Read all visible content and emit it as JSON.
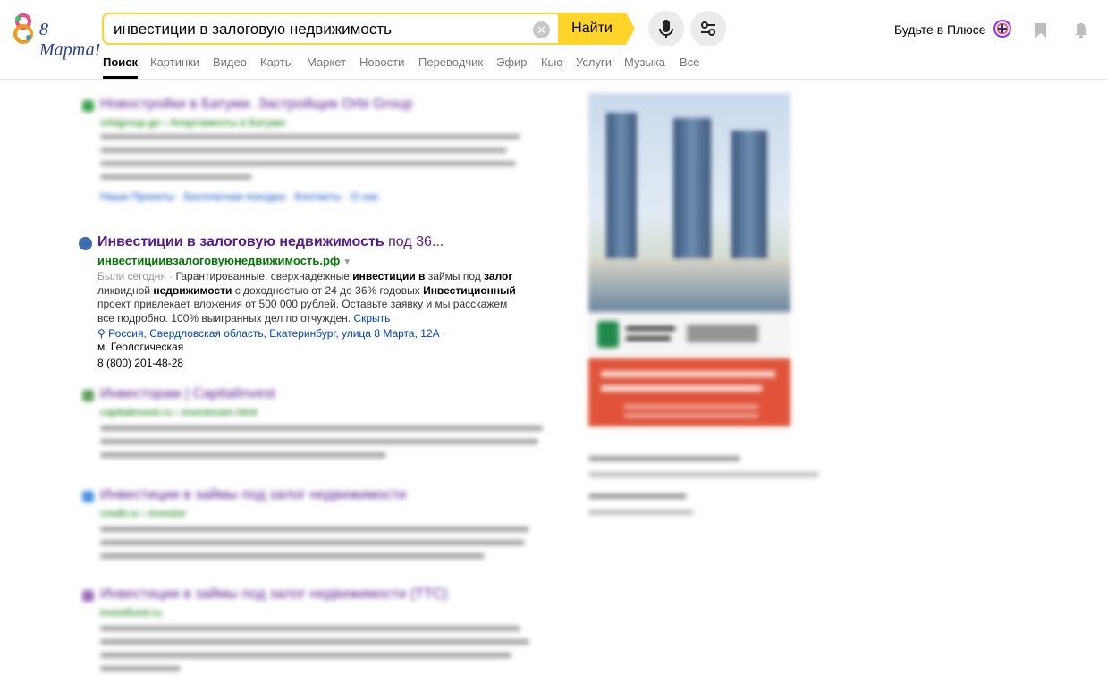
{
  "header": {
    "logo_text": "8 Марта!",
    "search_value": "инвестиции в залоговую недвижимость",
    "find_label": "Найти",
    "plus_label": "Будьте в Плюсе",
    "icons": [
      "clear-icon",
      "microphone-icon",
      "filter-settings-icon",
      "plus-logo-icon",
      "bookmark-icon",
      "bell-icon"
    ]
  },
  "tabs": [
    "Поиск",
    "Картинки",
    "Видео",
    "Карты",
    "Маркет",
    "Новости",
    "Переводчик",
    "Эфир",
    "Кью",
    "Услуги",
    "Музыка",
    "Все"
  ],
  "featured_result": {
    "title_bold": "Инвестиции в залоговую недвижимость",
    "title_rest": " под 36...",
    "url": "инвестициивзалоговуюнедвижимость.рф",
    "visited": "Были сегодня",
    "snippet_parts": [
      {
        "t": "Гарантированные, сверхнадежные ",
        "b": false
      },
      {
        "t": "инвестиции в",
        "b": true
      },
      {
        "t": " займы под ",
        "b": false
      },
      {
        "t": "залог",
        "b": true
      },
      {
        "t": " ликвидной ",
        "b": false
      },
      {
        "t": "недвижимости",
        "b": true
      },
      {
        "t": " с доходностью от 24 до 36% годовых ",
        "b": false
      },
      {
        "t": "Инвестиционный",
        "b": true
      },
      {
        "t": " проект привлекает вложения от 500 000 рублей. Оставьте заявку и мы расскажем все подробно. 100% выигранных дел по отчужден. ",
        "b": false
      }
    ],
    "hide_label": "Скрыть",
    "address": "Россия, Свердловская область, Екатеринбург, улица 8 Марта, 12А",
    "metro": "м. Геологическая",
    "phone": "8 (800) 201-48-28"
  },
  "blurred_results": [
    {
      "title": "Новостройки в Батуми. Застройщик Orbi Group",
      "url": "orbigroup.ge › Апартаменты в Батуми",
      "links": "Наши Проекты · Бесплатная поездка · Контакты · О нас"
    },
    {
      "title": "Инвесторам | CapitalInvest",
      "url": "capitalinvest.ru › investoram.html"
    },
    {
      "title": "Инвестиции в займы под залог недвижимости",
      "url": "credit.ru › investor"
    },
    {
      "title": "Инвестиции в займы под залог недвижимости (ТТС)",
      "url": "investfund.ru"
    }
  ],
  "colors": {
    "accent": "#fed42b",
    "link": "#551a8b",
    "url": "#007700",
    "blue_link": "#0044bb"
  }
}
